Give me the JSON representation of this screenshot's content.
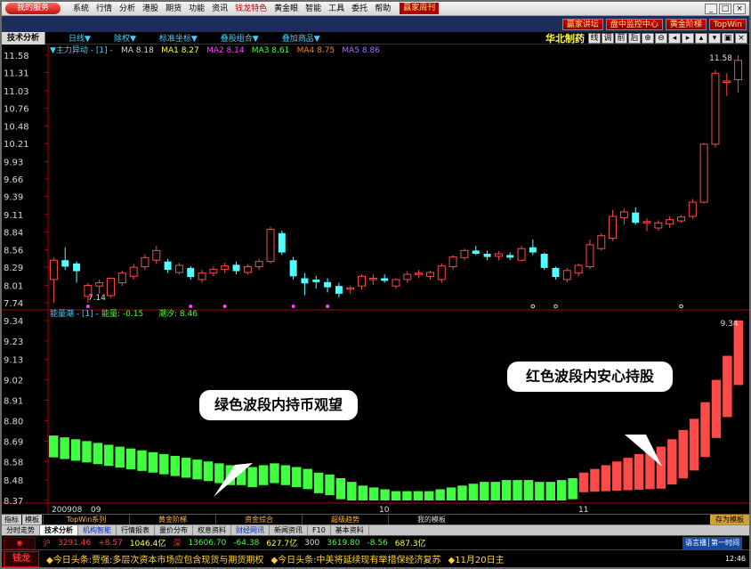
{
  "menu": {
    "logo": "我的服务",
    "items": [
      "系统",
      "行情",
      "分析",
      "港股",
      "期货",
      "功能",
      "资讯",
      "钱龙特色",
      "黄金眼",
      "智能",
      "工具",
      "委托",
      "帮助"
    ],
    "promo": "赢家周刊"
  },
  "topbar": {
    "pills": [
      "盘中监控中心",
      "黄金阶梯",
      "TopWin"
    ]
  },
  "promo_right": "赢家讲坛",
  "toolbar": {
    "active_tab": "技术分析",
    "items": [
      "日线▼",
      "除权▼",
      "标准坐标▼",
      "叠股组合▼",
      "叠加商品▼"
    ],
    "stock_name": "华北制药",
    "icons": [
      "线",
      "调",
      "前",
      "后",
      "?",
      "?",
      "?",
      "?",
      "?",
      "?",
      "?"
    ]
  },
  "price_panel": {
    "legend": "▼主力异动 - [1] -",
    "ma": [
      {
        "label": "MA",
        "value": "8.18",
        "color": "#d8d8d8"
      },
      {
        "label": "MA1",
        "value": "8.27",
        "color": "#ffff4a"
      },
      {
        "label": "MA2",
        "value": "8.14",
        "color": "#ff40ff"
      },
      {
        "label": "MA3",
        "value": "8.61",
        "color": "#40ff40"
      },
      {
        "label": "MA4",
        "value": "8.75",
        "color": "#ff7a30"
      },
      {
        "label": "MA5",
        "value": "8.86",
        "color": "#a070ff"
      }
    ],
    "y_ticks": [
      "11.58",
      "11.31",
      "11.03",
      "10.76",
      "10.48",
      "10.21",
      "9.93",
      "9.66",
      "9.39",
      "9.11",
      "8.84",
      "8.56",
      "8.29",
      "8.01",
      "7.74"
    ],
    "high_label": "11.58",
    "low_label": "7.14"
  },
  "ind_panel": {
    "legend": "能量潮 - [1] -",
    "values": [
      {
        "label": "能量:",
        "value": "-0.15",
        "color": "#40ff40"
      },
      {
        "label": "潮汐:",
        "value": "8.46",
        "color": "#40ff40"
      }
    ],
    "y_ticks": [
      "9.34",
      "9.23",
      "9.13",
      "9.02",
      "8.91",
      "8.80",
      "8.69",
      "8.58",
      "8.48",
      "8.37"
    ],
    "high_label": "9.34"
  },
  "x_labels": [
    "200908",
    "09",
    "10",
    "11"
  ],
  "callouts": {
    "green": "绿色波段内持币观望",
    "red": "红色波段内安心持股"
  },
  "chart_data": [
    {
      "type": "candlestick",
      "title": "华北制药",
      "y_range": [
        7.74,
        11.58
      ],
      "candles": [
        {
          "o": 8.1,
          "h": 8.44,
          "l": 7.74,
          "c": 8.4
        },
        {
          "o": 8.4,
          "h": 8.6,
          "l": 8.25,
          "c": 8.3
        },
        {
          "o": 8.35,
          "h": 8.38,
          "l": 8.05,
          "c": 8.23
        },
        {
          "o": 7.84,
          "h": 8.05,
          "l": 7.74,
          "c": 8.01
        },
        {
          "o": 8.0,
          "h": 8.1,
          "l": 7.88,
          "c": 8.05
        },
        {
          "o": 7.85,
          "h": 8.12,
          "l": 7.82,
          "c": 8.12
        },
        {
          "o": 8.05,
          "h": 8.24,
          "l": 8.0,
          "c": 8.2
        },
        {
          "o": 8.15,
          "h": 8.34,
          "l": 8.1,
          "c": 8.29
        },
        {
          "o": 8.3,
          "h": 8.49,
          "l": 8.25,
          "c": 8.44
        },
        {
          "o": 8.4,
          "h": 8.62,
          "l": 8.35,
          "c": 8.55
        },
        {
          "o": 8.38,
          "h": 8.42,
          "l": 8.2,
          "c": 8.25
        },
        {
          "o": 8.21,
          "h": 8.36,
          "l": 8.18,
          "c": 8.32
        },
        {
          "o": 8.28,
          "h": 8.31,
          "l": 8.1,
          "c": 8.14
        },
        {
          "o": 8.1,
          "h": 8.25,
          "l": 8.05,
          "c": 8.2
        },
        {
          "o": 8.2,
          "h": 8.3,
          "l": 8.15,
          "c": 8.26
        },
        {
          "o": 8.26,
          "h": 8.36,
          "l": 8.2,
          "c": 8.31
        },
        {
          "o": 8.33,
          "h": 8.38,
          "l": 8.18,
          "c": 8.23
        },
        {
          "o": 8.21,
          "h": 8.34,
          "l": 8.18,
          "c": 8.3
        },
        {
          "o": 8.3,
          "h": 8.42,
          "l": 8.25,
          "c": 8.38
        },
        {
          "o": 8.38,
          "h": 8.92,
          "l": 8.35,
          "c": 8.88
        },
        {
          "o": 8.82,
          "h": 8.86,
          "l": 8.48,
          "c": 8.52
        },
        {
          "o": 8.4,
          "h": 8.45,
          "l": 8.1,
          "c": 8.15
        },
        {
          "o": 8.12,
          "h": 8.2,
          "l": 7.86,
          "c": 8.04
        },
        {
          "o": 8.1,
          "h": 8.16,
          "l": 7.96,
          "c": 8.06
        },
        {
          "o": 8.06,
          "h": 8.12,
          "l": 7.9,
          "c": 7.98
        },
        {
          "o": 8.0,
          "h": 8.05,
          "l": 7.82,
          "c": 7.88
        },
        {
          "o": 7.95,
          "h": 8.0,
          "l": 7.88,
          "c": 7.97
        },
        {
          "o": 8.0,
          "h": 8.18,
          "l": 7.95,
          "c": 8.15
        },
        {
          "o": 8.1,
          "h": 8.18,
          "l": 8.02,
          "c": 8.12
        },
        {
          "o": 8.12,
          "h": 8.18,
          "l": 8.05,
          "c": 8.08
        },
        {
          "o": 8.0,
          "h": 8.12,
          "l": 7.96,
          "c": 8.1
        },
        {
          "o": 8.1,
          "h": 8.22,
          "l": 8.05,
          "c": 8.18
        },
        {
          "o": 8.18,
          "h": 8.25,
          "l": 8.12,
          "c": 8.2
        },
        {
          "o": 8.15,
          "h": 8.24,
          "l": 8.1,
          "c": 8.21
        },
        {
          "o": 8.1,
          "h": 8.35,
          "l": 8.05,
          "c": 8.31
        },
        {
          "o": 8.3,
          "h": 8.48,
          "l": 8.25,
          "c": 8.45
        },
        {
          "o": 8.44,
          "h": 8.58,
          "l": 8.4,
          "c": 8.55
        },
        {
          "o": 8.55,
          "h": 8.62,
          "l": 8.48,
          "c": 8.5
        },
        {
          "o": 8.5,
          "h": 8.55,
          "l": 8.4,
          "c": 8.45
        },
        {
          "o": 8.46,
          "h": 8.54,
          "l": 8.4,
          "c": 8.5
        },
        {
          "o": 8.48,
          "h": 8.52,
          "l": 8.4,
          "c": 8.44
        },
        {
          "o": 8.4,
          "h": 8.62,
          "l": 8.38,
          "c": 8.58
        },
        {
          "o": 8.6,
          "h": 8.72,
          "l": 8.48,
          "c": 8.52
        },
        {
          "o": 8.5,
          "h": 8.52,
          "l": 8.25,
          "c": 8.28
        },
        {
          "o": 8.28,
          "h": 8.3,
          "l": 8.1,
          "c": 8.14
        },
        {
          "o": 8.1,
          "h": 8.28,
          "l": 8.06,
          "c": 8.24
        },
        {
          "o": 8.2,
          "h": 8.35,
          "l": 8.15,
          "c": 8.32
        },
        {
          "o": 8.3,
          "h": 8.72,
          "l": 8.26,
          "c": 8.64
        },
        {
          "o": 8.58,
          "h": 8.82,
          "l": 8.55,
          "c": 8.78
        },
        {
          "o": 8.74,
          "h": 9.18,
          "l": 8.7,
          "c": 9.08
        },
        {
          "o": 9.06,
          "h": 9.2,
          "l": 8.96,
          "c": 9.15
        },
        {
          "o": 9.14,
          "h": 9.22,
          "l": 8.95,
          "c": 8.98
        },
        {
          "o": 9.0,
          "h": 9.05,
          "l": 8.85,
          "c": 9.0
        },
        {
          "o": 8.9,
          "h": 9.02,
          "l": 8.86,
          "c": 8.98
        },
        {
          "o": 8.96,
          "h": 9.08,
          "l": 8.9,
          "c": 9.03
        },
        {
          "o": 9.01,
          "h": 9.1,
          "l": 8.98,
          "c": 9.07
        },
        {
          "o": 9.08,
          "h": 9.35,
          "l": 9.04,
          "c": 9.3
        },
        {
          "o": 9.3,
          "h": 10.22,
          "l": 9.28,
          "c": 10.2
        },
        {
          "o": 10.2,
          "h": 11.35,
          "l": 10.15,
          "c": 11.3
        },
        {
          "o": 11.18,
          "h": 11.3,
          "l": 10.95,
          "c": 11.18
        },
        {
          "o": 11.2,
          "h": 11.58,
          "l": 11.0,
          "c": 11.5
        }
      ]
    },
    {
      "type": "bar",
      "title": "能量潮",
      "y_range": [
        8.37,
        9.34
      ],
      "series": [
        {
          "name": "绿色",
          "color": "#40ff40",
          "values": [
            8.72,
            8.71,
            8.7,
            8.69,
            8.68,
            8.67,
            8.66,
            8.65,
            8.64,
            8.63,
            8.62,
            8.61,
            8.6,
            8.59,
            8.58,
            8.57,
            8.56,
            8.56,
            8.55,
            8.56,
            8.57,
            8.56,
            8.55,
            8.54,
            8.52,
            8.51,
            8.49,
            8.47,
            8.45,
            8.44,
            8.43,
            8.42,
            8.42,
            8.42,
            8.42,
            8.43,
            8.44,
            8.45,
            8.46,
            8.47,
            8.47,
            8.48,
            8.48,
            8.48,
            8.47,
            8.47,
            8.48,
            8.49
          ],
          "range": [
            0,
            47
          ]
        },
        {
          "name": "红色",
          "color": "#ff4a4a",
          "values": [
            8.52,
            8.54,
            8.56,
            8.58,
            8.6,
            8.62,
            8.64,
            8.66,
            8.7,
            8.75,
            8.81,
            8.9,
            9.02,
            9.15,
            9.34
          ],
          "range": [
            48,
            62
          ]
        }
      ]
    }
  ],
  "bottom_bar": {
    "small": [
      "指标",
      "模板"
    ],
    "segments": [
      "TopWin系列",
      "黄金阶梯",
      "资金综合",
      "超级趋势",
      "我的模板"
    ],
    "right": "存为模板"
  },
  "tabs": [
    "分时走势",
    "技术分析",
    "机构智能",
    "行情报表",
    "量价分布",
    "权息资料",
    "财经网讯",
    "新闻资讯",
    "F10",
    "基本资料"
  ],
  "quotes": {
    "sh_name": "沪",
    "sh_price": "3291.46",
    "sh_chg": "+8.57",
    "sh_amt": "1046.4亿",
    "sz_name": "深",
    "sz_price": "13606.70",
    "sz_chg": "-64.38",
    "sz_amt": "627.7亿",
    "c300_name": "300",
    "c300_price": "3619.80",
    "c300_chg": "-8.56",
    "c300_amt": "687.3亿",
    "tip": "语言播│第一时间"
  },
  "news": {
    "logo": "钱龙",
    "items": [
      "◆今日头条:贾强:多层次资本市场应包含现货与期货期权",
      "◆今日头条:中美将延续现有举措保经济复苏",
      "◆11月20日主"
    ],
    "time": "12:46"
  }
}
